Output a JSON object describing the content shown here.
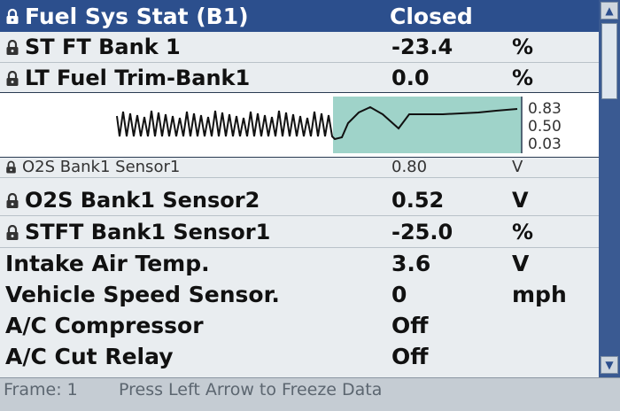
{
  "header": {
    "label": "Fuel Sys Stat (B1)",
    "value": "Closed",
    "icon": "lock-icon"
  },
  "rows_top": [
    {
      "label": "ST FT Bank 1",
      "value": "-23.4",
      "unit": "%"
    },
    {
      "label": "LT Fuel Trim-Bank1",
      "value": "0.0",
      "unit": "%"
    }
  ],
  "graph": {
    "scale": [
      "0.83",
      "0.50",
      "0.03"
    ],
    "highlight_color": "#9fd3c9"
  },
  "graph_row": {
    "label": "O2S Bank1 Sensor1",
    "value": "0.80",
    "unit": "V"
  },
  "rows_locked": [
    {
      "label": "O2S Bank1 Sensor2",
      "value": "0.52",
      "unit": "V"
    },
    {
      "label": "STFT Bank1 Sensor1",
      "value": "-25.0",
      "unit": "%"
    }
  ],
  "rows_plain": [
    {
      "label": "Intake Air Temp.",
      "value": "3.6",
      "unit": "V"
    },
    {
      "label": "Vehicle Speed Sensor.",
      "value": "0",
      "unit": "mph"
    },
    {
      "label": "A/C Compressor",
      "value": "Off",
      "unit": ""
    },
    {
      "label": "A/C Cut Relay",
      "value": "Off",
      "unit": ""
    }
  ],
  "status": {
    "frame": "Frame: 1",
    "message": "Press Left Arrow to Freeze Data"
  },
  "colors": {
    "header_bg": "#2c4f8d",
    "screen_bg": "#e9edf0",
    "graph_highlight": "#9fd3c9"
  }
}
